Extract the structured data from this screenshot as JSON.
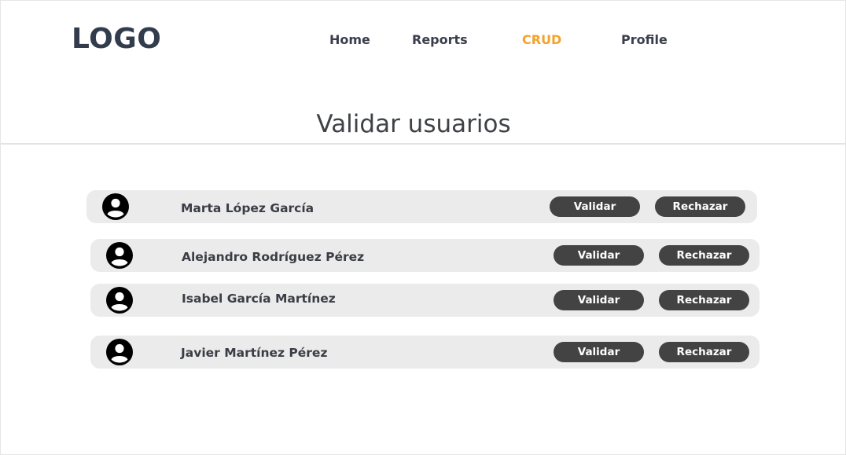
{
  "header": {
    "logo": "LOGO",
    "nav": [
      {
        "label": "Home",
        "active": false
      },
      {
        "label": "Reports",
        "active": false
      },
      {
        "label": "CRUD",
        "active": true
      },
      {
        "label": "Profile",
        "active": false
      }
    ]
  },
  "page": {
    "title": "Validar usuarios"
  },
  "users": [
    {
      "name": "Marta López García",
      "validate_label": "Validar",
      "reject_label": "Rechazar"
    },
    {
      "name": "Alejandro Rodríguez Pérez",
      "validate_label": "Validar",
      "reject_label": "Rechazar"
    },
    {
      "name": "Isabel García Martínez",
      "validate_label": "Validar",
      "reject_label": "Rechazar"
    },
    {
      "name": "Javier Martínez Pérez",
      "validate_label": "Validar",
      "reject_label": "Rechazar"
    }
  ],
  "icons": {
    "avatar": "user-avatar-icon"
  },
  "colors": {
    "accent": "#f4a22d",
    "nav_text": "#3a3f4b",
    "button_bg": "#434343",
    "row_bg": "#ebebeb"
  }
}
